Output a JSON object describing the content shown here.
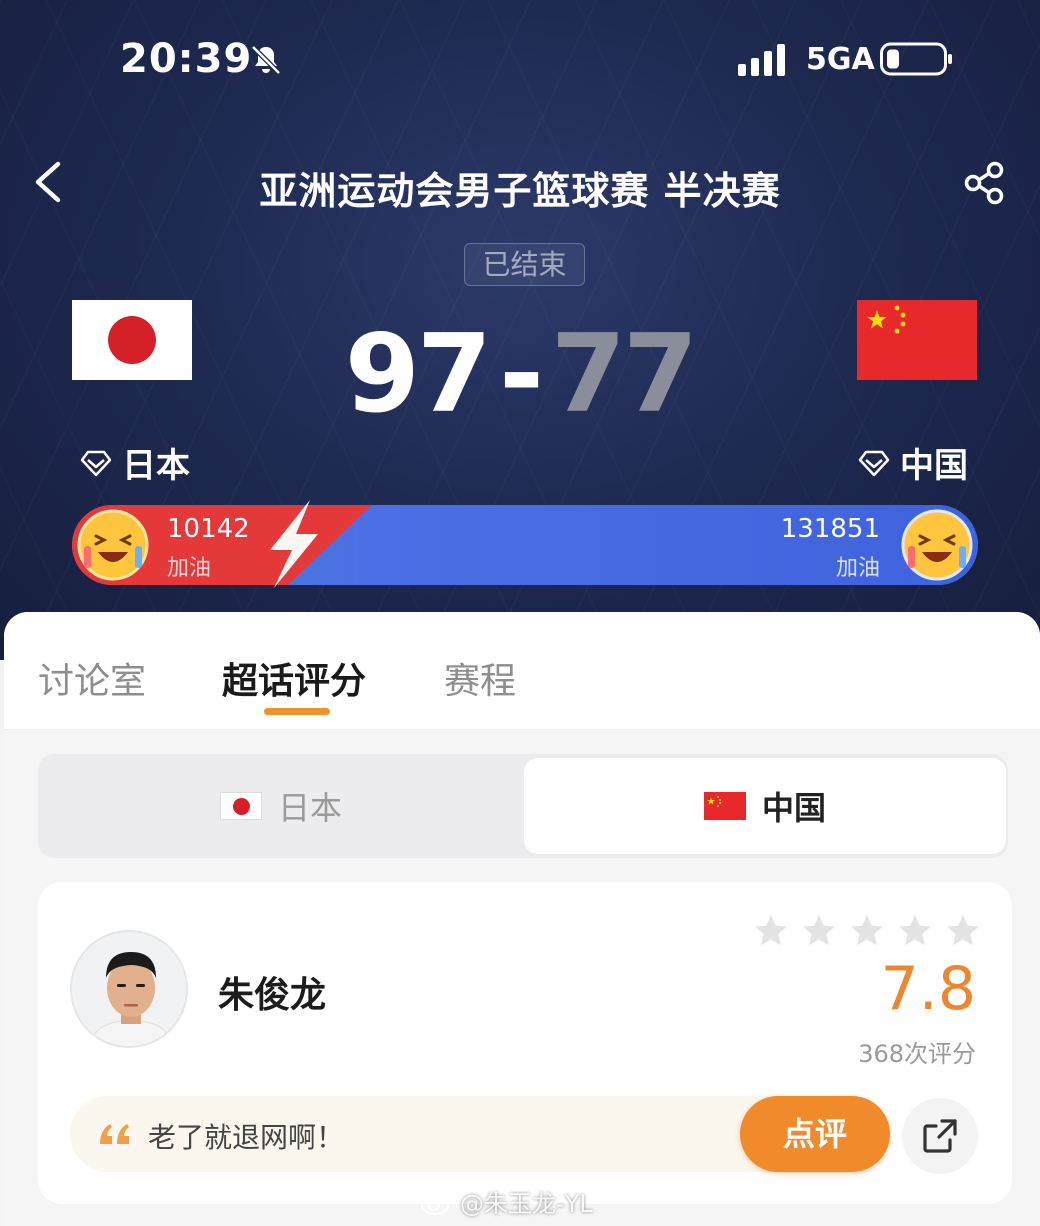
{
  "status_bar": {
    "time": "20:39",
    "network": "5GA"
  },
  "header": {
    "title": "亚洲运动会男子篮球赛 半决赛"
  },
  "match": {
    "status": "已结束",
    "home": {
      "name": "日本",
      "score": "97"
    },
    "away": {
      "name": "中国",
      "score": "77"
    },
    "score_separator": "-"
  },
  "cheer": {
    "home": {
      "count": "10142",
      "label": "加油"
    },
    "away": {
      "count": "131851",
      "label": "加油"
    }
  },
  "tabs": [
    {
      "label": "讨论室"
    },
    {
      "label": "超话评分"
    },
    {
      "label": "赛程"
    }
  ],
  "team_switch": {
    "left": "日本",
    "right": "中国"
  },
  "player_card": {
    "name": "朱俊龙",
    "rating": "7.8",
    "rating_count": "368次评分",
    "stars_filled": 0,
    "stars_total": 5,
    "comment": "老了就退网啊！",
    "comment_button": "点评"
  },
  "watermark": "@朱玉龙-YL",
  "colors": {
    "accent": "#f08a2a",
    "home_bar": "#e53939",
    "away_bar": "#4a72e0"
  }
}
